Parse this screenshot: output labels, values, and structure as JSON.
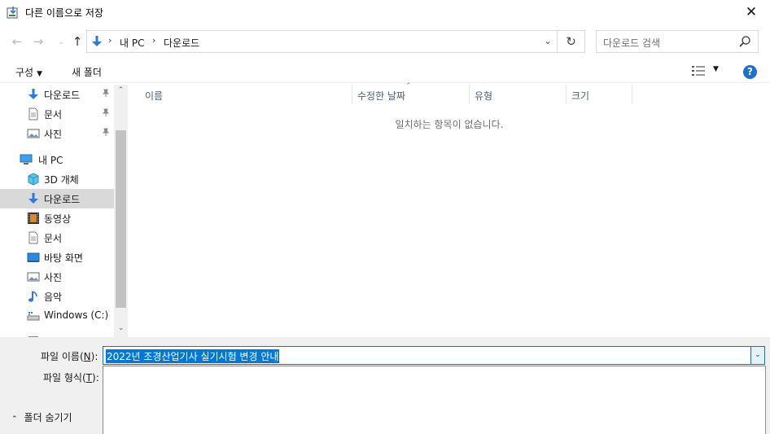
{
  "window": {
    "title": "다른 이름으로 저장",
    "close_glyph": "✕"
  },
  "nav": {
    "back_glyph": "←",
    "forward_glyph": "→",
    "recent_glyph": "⌄",
    "up_glyph": "↑",
    "breadcrumbs": [
      "내 PC",
      "다운로드"
    ],
    "separator": "›",
    "dropdown_glyph": "⌄",
    "refresh_glyph": "↻",
    "search_placeholder": "다운로드 검색"
  },
  "toolbar": {
    "organize_label": "구성",
    "organize_caret": "▼",
    "new_folder_label": "새 폴더",
    "view_caret": "▼",
    "help_label": "?"
  },
  "sidebar": {
    "quick_access": [
      {
        "label": "다운로드",
        "icon": "download-icon",
        "pinned": true
      },
      {
        "label": "문서",
        "icon": "document-icon",
        "pinned": true
      },
      {
        "label": "사진",
        "icon": "picture-icon",
        "pinned": true
      }
    ],
    "this_pc": {
      "label": "내 PC",
      "icon": "computer-icon",
      "items": [
        {
          "label": "3D 개체",
          "icon": "cube-icon"
        },
        {
          "label": "다운로드",
          "icon": "download-icon",
          "selected": true
        },
        {
          "label": "동영상",
          "icon": "video-icon"
        },
        {
          "label": "문서",
          "icon": "document-icon"
        },
        {
          "label": "바탕 화면",
          "icon": "desktop-icon"
        },
        {
          "label": "사진",
          "icon": "picture-icon"
        },
        {
          "label": "음악",
          "icon": "music-icon"
        },
        {
          "label": "Windows (C:)",
          "icon": "drive-icon"
        }
      ]
    },
    "pin_glyph": "📌",
    "scroll_up_glyph": "⌃",
    "scroll_down_glyph": "⌄"
  },
  "file_list": {
    "columns": [
      "이름",
      "수정한 날짜",
      "유형",
      "크기"
    ],
    "sort_glyph": "⌃",
    "empty_message": "일치하는 항목이 없습니다."
  },
  "save_form": {
    "filename_label": "파일 이름(N):",
    "filename_label_main": "파일 이름(",
    "filename_label_key": "N",
    "filename_label_end": "):",
    "filename_value": "2022년 조경산업기사 실기시험 변경 안내",
    "filetype_label_main": "파일 형식(",
    "filetype_label_key": "T",
    "filetype_label_end": "):",
    "dropdown_glyph": "⌄",
    "hide_folders_label": "폴더 숨기기",
    "hide_folders_glyph": "⌃"
  },
  "colors": {
    "accent": "#0078d7",
    "selected_row": "#d9d9d9",
    "help_blue": "#1f6fd1",
    "download_arrow": "#2b7bd6"
  }
}
